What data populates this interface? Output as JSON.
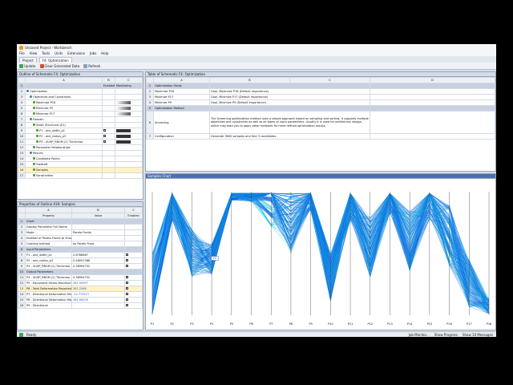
{
  "window": {
    "title": "Unsaved Project - Workbench"
  },
  "menu": [
    "File",
    "View",
    "Tools",
    "Units",
    "Extensions",
    "Jobs",
    "Help"
  ],
  "tabs": [
    {
      "label": "Project"
    },
    {
      "label": "F4: Optimization"
    }
  ],
  "toolbar": {
    "update": "Update",
    "clear": "Clear Generated Data",
    "refresh": "Refresh"
  },
  "outline": {
    "title": "Outline of Schematic F4: Optimization",
    "columns": [
      "A",
      "B",
      "C"
    ],
    "col_labels": [
      "",
      "Enabled",
      "Monitoring"
    ],
    "rows": [
      {
        "n": "1",
        "label": "",
        "head": true
      },
      {
        "n": "2",
        "label": "Optimization"
      },
      {
        "n": "3",
        "label": "Objectives and Constraints"
      },
      {
        "n": "4",
        "label": "Maximize P18"
      },
      {
        "n": "5",
        "label": "Minimize P9"
      },
      {
        "n": "6",
        "label": "Minimize P17"
      },
      {
        "n": "7",
        "label": "Domain"
      },
      {
        "n": "8",
        "label": "Static Structural (E1)"
      },
      {
        "n": "9",
        "label": "P1 - ane_width_p1"
      },
      {
        "n": "10",
        "label": "P2 - ane_radius_p3"
      },
      {
        "n": "11",
        "label": "P3 - ULMP_RBOM (2) Thickness"
      },
      {
        "n": "12",
        "label": "Parameter Relationships"
      },
      {
        "n": "13",
        "label": "Results"
      },
      {
        "n": "14",
        "label": "Candidate Points"
      },
      {
        "n": "15",
        "label": "Tradeoff"
      },
      {
        "n": "16",
        "label": "Samples"
      },
      {
        "n": "17",
        "label": "Sensitivities"
      }
    ]
  },
  "properties": {
    "title": "Properties of Outline A16: Samples",
    "columns": [
      "A",
      "B",
      "C"
    ],
    "col_labels": [
      "Property",
      "Value",
      "Enabled"
    ],
    "rows": [
      {
        "n": "1",
        "a": "Chart",
        "b": "",
        "sect": true
      },
      {
        "n": "2",
        "a": "Display Parameter Full Name",
        "b": ""
      },
      {
        "n": "3",
        "a": "Mode",
        "b": "Pareto Fronts"
      },
      {
        "n": "4",
        "a": "Number of Pareto Fronts to Show",
        "b": ""
      },
      {
        "n": "5",
        "a": "Coloring method",
        "b": "by Pareto Front"
      },
      {
        "n": "6",
        "a": "Input Parameters",
        "b": "",
        "sect": true
      },
      {
        "n": "7",
        "a": "P1 - ane_width_p1",
        "b": "2.6786667"
      },
      {
        "n": "8",
        "a": "P2 - ane_radius_p3",
        "b": "0.46091388"
      },
      {
        "n": "9",
        "a": "P3 - ULMP_RBOM (2) Thickness",
        "b": "0.38994752"
      },
      {
        "n": "10",
        "a": "Output Parameters",
        "b": "",
        "sect": true
      },
      {
        "n": "11",
        "a": "P4 - ULMP_RBOM (2) Thickness",
        "b": "0.38994752"
      },
      {
        "n": "12",
        "a": "P5 - Equivalent Stress Maximum",
        "b": "361.94997",
        "link": true
      },
      {
        "n": "13",
        "a": "P6 - Total Deformation Reported Frequency",
        "b": "361.2566",
        "link": true,
        "hl": true
      },
      {
        "n": "14",
        "a": "P7 - Directional Deformation Minimum",
        "b": "-12.770577",
        "link": true
      },
      {
        "n": "15",
        "a": "P8 - Directional Deformation Maximum",
        "b": "361.95035",
        "link": true
      },
      {
        "n": "16",
        "a": "P9 - Directional",
        "b": ""
      }
    ]
  },
  "table_panel": {
    "title": "Table of Schematic F4: Optimization",
    "columns": [
      "A",
      "B",
      "C",
      "D"
    ],
    "rows": [
      {
        "n": "1",
        "a": "Optimization Study",
        "b": "",
        "sect": true
      },
      {
        "n": "2",
        "a": "Maximize P18",
        "b": "Goal, Maximize P18 (Default importance)"
      },
      {
        "n": "3",
        "a": "Minimize P17",
        "b": "Goal, Minimize P17 (Default importance)"
      },
      {
        "n": "4",
        "a": "Minimize P9",
        "b": "Goal, Minimize P9 (Default importance)"
      },
      {
        "n": "5",
        "a": "Optimization Method",
        "b": "",
        "sect": true
      },
      {
        "n": "6",
        "a": "Screening",
        "b": "The Screening optimization method uses a simple approach based on sampling and sorting. It supports multiple objectives and constraints as well as all types of input parameters. Usually it is used for preliminary design, which may lead you to apply other methods for more refined optimization results.",
        "tall": true
      },
      {
        "n": "7",
        "a": "Configuration",
        "b": "Generate 3600 samples and find 3 candidates."
      }
    ]
  },
  "chart_panel": {
    "title": "Samples Chart",
    "marker_label": "P4"
  },
  "chart_data": {
    "type": "line",
    "subtype": "parallel-coordinates",
    "axes": [
      "P1",
      "P2",
      "P3",
      "P4",
      "P5",
      "P6",
      "P7",
      "P8",
      "P9",
      "P10",
      "P11",
      "P12",
      "P13",
      "P14",
      "P15",
      "P16",
      "P17",
      "P18"
    ],
    "series_colors": [
      "#0a50d8",
      "#0f6fe6",
      "#1f8ff0",
      "#19c3d8"
    ]
  },
  "status": {
    "left": "Ready",
    "job_monitor": "Job Monitor...",
    "show_progress": "Show Progress",
    "messages": "Show 10 Messages"
  },
  "colors": {
    "accent": "#2a58b8",
    "lines": "#0b5ed7"
  }
}
